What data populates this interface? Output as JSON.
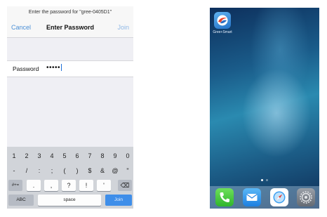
{
  "password_screen": {
    "prompt": "Enter the password for \"gree-0405D1\"",
    "nav": {
      "cancel": "Cancel",
      "title": "Enter Password",
      "join": "Join"
    },
    "field": {
      "label": "Password",
      "value": "•••••"
    },
    "keyboard": {
      "row1": [
        "1",
        "2",
        "3",
        "4",
        "5",
        "6",
        "7",
        "8",
        "9",
        "0"
      ],
      "row2": [
        "-",
        "/",
        ":",
        ";",
        "(",
        ")",
        "$",
        "&",
        "@",
        "\""
      ],
      "row3": [
        "#+=",
        ".",
        ",",
        "?",
        "!",
        "'",
        "⌫"
      ],
      "row4": {
        "abc": "ABC",
        "space": "space",
        "join": "Join"
      }
    },
    "colors": {
      "link": "#4a8fd6",
      "join_key": "#3f8ee9"
    }
  },
  "home_screen": {
    "app": {
      "label": "Gree+Smart",
      "icon": "gree-smart-app-icon"
    },
    "dock": [
      {
        "icon": "phone-icon"
      },
      {
        "icon": "mail-icon"
      },
      {
        "icon": "safari-icon"
      },
      {
        "icon": "settings-icon"
      }
    ]
  }
}
